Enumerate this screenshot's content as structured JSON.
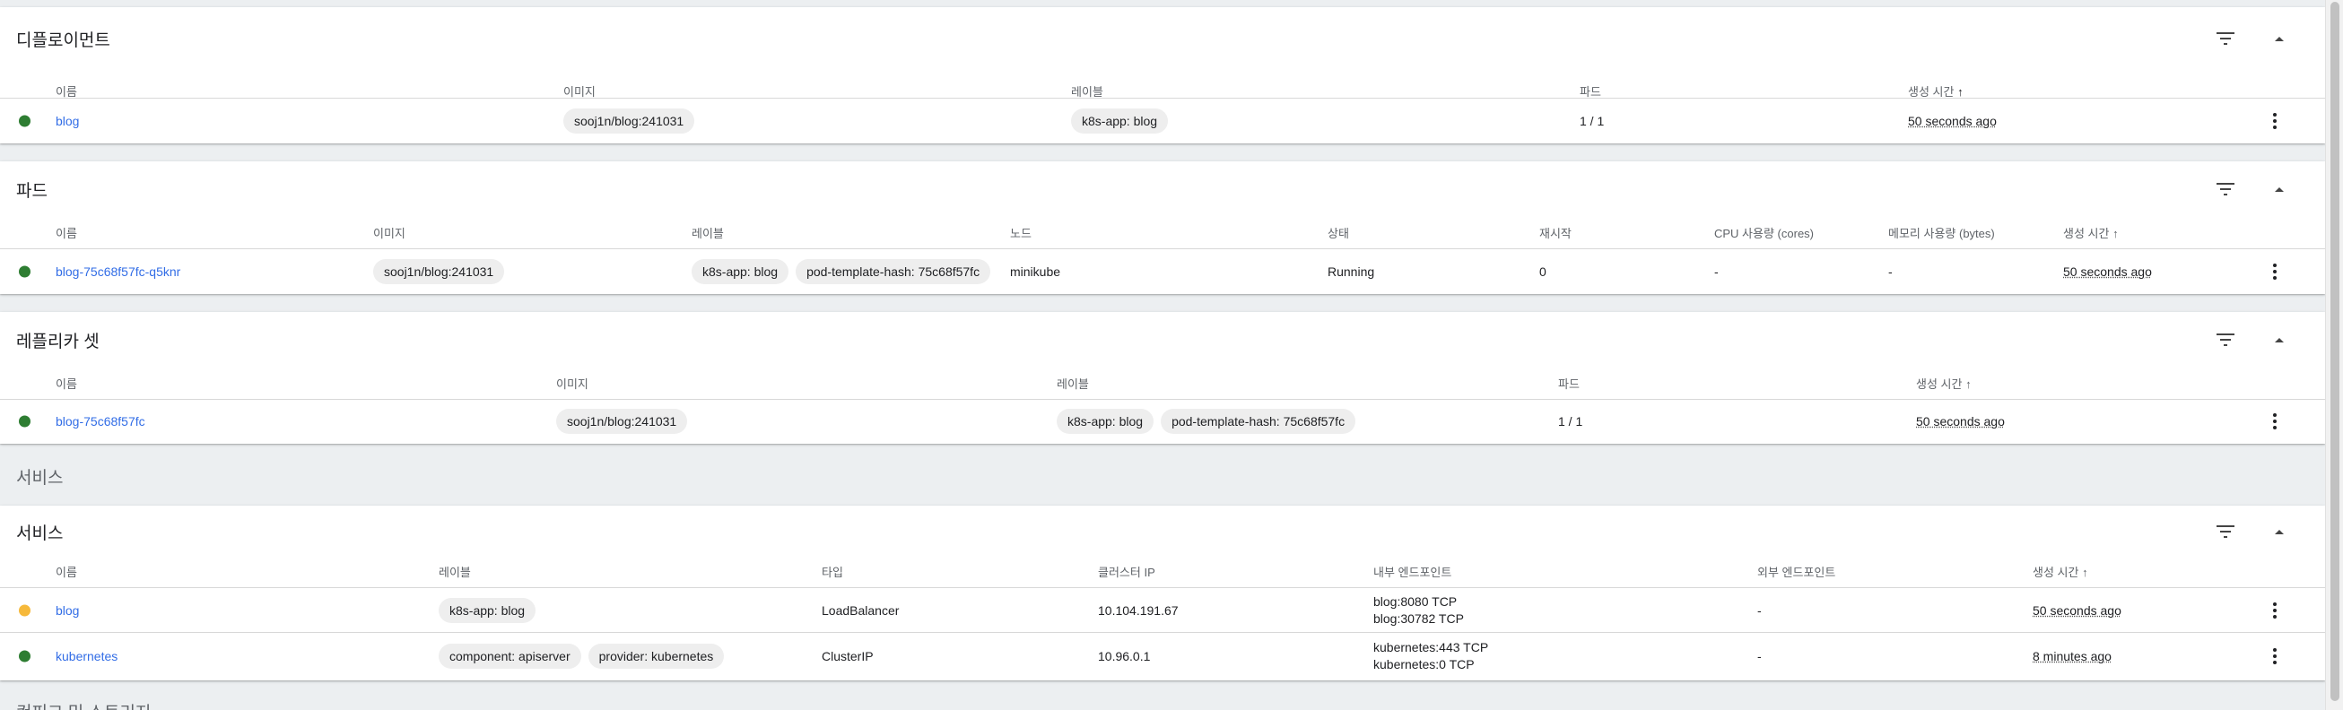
{
  "deployments": {
    "title": "디플로이먼트",
    "headers": [
      "이름",
      "이미지",
      "레이블",
      "파드",
      "생성 시간"
    ],
    "sort_icon": "arrow-up-icon",
    "rows": [
      {
        "status": "green",
        "name": "blog",
        "image": "sooj1n/blog:241031",
        "labels": [
          "k8s-app: blog"
        ],
        "pods": "1 / 1",
        "created": "50 seconds ago"
      }
    ]
  },
  "pods": {
    "title": "파드",
    "headers": [
      "이름",
      "이미지",
      "레이블",
      "노드",
      "상태",
      "재시작",
      "CPU 사용량 (cores)",
      "메모리 사용량 (bytes)",
      "생성 시간"
    ],
    "rows": [
      {
        "status": "green",
        "name": "blog-75c68f57fc-q5knr",
        "image": "sooj1n/blog:241031",
        "labels": [
          "k8s-app: blog",
          "pod-template-hash: 75c68f57fc"
        ],
        "node": "minikube",
        "state": "Running",
        "restarts": "0",
        "cpu": "-",
        "memory": "-",
        "created": "50 seconds ago"
      }
    ]
  },
  "replicasets": {
    "title": "레플리카 셋",
    "headers": [
      "이름",
      "이미지",
      "레이블",
      "파드",
      "생성 시간"
    ],
    "rows": [
      {
        "status": "green",
        "name": "blog-75c68f57fc",
        "image": "sooj1n/blog:241031",
        "labels": [
          "k8s-app: blog",
          "pod-template-hash: 75c68f57fc"
        ],
        "pods": "1 / 1",
        "created": "50 seconds ago"
      }
    ]
  },
  "services_section_label": "서비스",
  "services": {
    "title": "서비스",
    "headers": [
      "이름",
      "레이블",
      "타입",
      "클러스터 IP",
      "내부 엔드포인트",
      "외부 엔드포인트",
      "생성 시간"
    ],
    "rows": [
      {
        "status": "yellow",
        "name": "blog",
        "labels": [
          "k8s-app: blog"
        ],
        "type": "LoadBalancer",
        "cluster_ip": "10.104.191.67",
        "internal": [
          "blog:8080 TCP",
          "blog:30782 TCP"
        ],
        "external": "-",
        "created": "50 seconds ago"
      },
      {
        "status": "green",
        "name": "kubernetes",
        "labels": [
          "component: apiserver",
          "provider: kubernetes"
        ],
        "type": "ClusterIP",
        "cluster_ip": "10.96.0.1",
        "internal": [
          "kubernetes:443 TCP",
          "kubernetes:0 TCP"
        ],
        "external": "-",
        "created": "8 minutes ago"
      }
    ]
  },
  "next_section_label": "컨피그 및 스토리지",
  "colors": {
    "green": "#2e7d32",
    "yellow": "#f6b93b",
    "link": "#326de6"
  },
  "icons": {
    "filter": "filter-icon",
    "collapse": "chevron-up-icon",
    "menu": "more-vert-icon"
  }
}
